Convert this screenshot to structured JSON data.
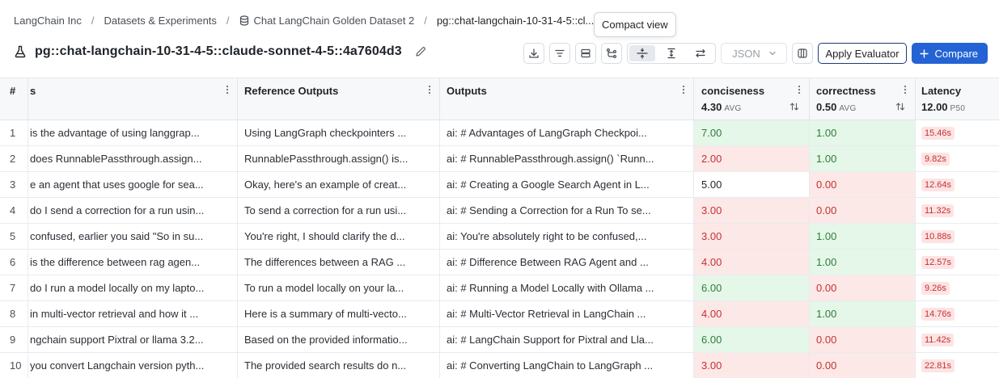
{
  "breadcrumb": {
    "items": [
      "LangChain Inc",
      "Datasets & Experiments",
      "Chat LangChain Golden Dataset 2",
      "pg::chat-langchain-10-31-4-5::cl..."
    ],
    "separator": "/"
  },
  "tooltip": {
    "text": "Compact view"
  },
  "header": {
    "title": "pg::chat-langchain-10-31-4-5::claude-sonnet-4-5::4a7604d3"
  },
  "toolbar": {
    "format_select": "JSON",
    "apply_label": "Apply Evaluator",
    "compare_label": "Compare",
    "icons": [
      "download-icon",
      "filter-icon",
      "rows-icon",
      "branch-icon",
      "compact-view-icon",
      "expand-view-icon",
      "swap-icon",
      "columns-icon"
    ]
  },
  "colors": {
    "accent": "#2463d4",
    "good_bg": "#e5f7e8",
    "good_text": "#2e7d3a",
    "bad_bg": "#fde8e8",
    "bad_text": "#c53030"
  },
  "table": {
    "columns": {
      "num": "#",
      "inputs": "s",
      "reference": "Reference Outputs",
      "outputs": "Outputs",
      "conciseness": {
        "label": "conciseness",
        "value": "4.30",
        "unit": "AVG"
      },
      "correctness": {
        "label": "correctness",
        "value": "0.50",
        "unit": "AVG"
      },
      "latency": {
        "label": "Latency",
        "value": "12.00",
        "unit": "P50"
      }
    },
    "rows": [
      {
        "num": "1",
        "input": "is the advantage of using langgrap...",
        "reference": "Using LangGraph checkpointers ...",
        "output": "ai: # Advantages of LangGraph Checkpoi...",
        "conciseness": "7.00",
        "con_status": "good",
        "correctness": "1.00",
        "cor_status": "good",
        "latency": "15.46s"
      },
      {
        "num": "2",
        "input": "does RunnablePassthrough.assign...",
        "reference": "RunnablePassthrough.assign() is...",
        "output": "ai: # RunnablePassthrough.assign() `Runn...",
        "conciseness": "2.00",
        "con_status": "bad",
        "correctness": "1.00",
        "cor_status": "good",
        "latency": "9.82s"
      },
      {
        "num": "3",
        "input": "e an agent that uses google for sea...",
        "reference": "Okay, here's an example of creat...",
        "output": "ai: # Creating a Google Search Agent in L...",
        "conciseness": "5.00",
        "con_status": "neutral",
        "correctness": "0.00",
        "cor_status": "bad",
        "latency": "12.64s"
      },
      {
        "num": "4",
        "input": "do I send a correction for a run usin...",
        "reference": "To send a correction for a run usi...",
        "output": "ai: # Sending a Correction for a Run To se...",
        "conciseness": "3.00",
        "con_status": "bad",
        "correctness": "0.00",
        "cor_status": "bad",
        "latency": "11.32s"
      },
      {
        "num": "5",
        "input": "confused, earlier you said \"So in su...",
        "reference": "You're right, I should clarify the d...",
        "output": "ai: You're absolutely right to be confused,...",
        "conciseness": "3.00",
        "con_status": "bad",
        "correctness": "1.00",
        "cor_status": "good",
        "latency": "10.88s"
      },
      {
        "num": "6",
        "input": "is the difference between rag agen...",
        "reference": "The differences between a RAG ...",
        "output": "ai: # Difference Between RAG Agent and ...",
        "conciseness": "4.00",
        "con_status": "bad",
        "correctness": "1.00",
        "cor_status": "good",
        "latency": "12.57s"
      },
      {
        "num": "7",
        "input": "do I run a model locally on my lapto...",
        "reference": "To run a model locally on your la...",
        "output": "ai: # Running a Model Locally with Ollama ...",
        "conciseness": "6.00",
        "con_status": "good",
        "correctness": "0.00",
        "cor_status": "bad",
        "latency": "9.26s"
      },
      {
        "num": "8",
        "input": "in multi-vector retrieval and how it ...",
        "reference": "Here is a summary of multi-vecto...",
        "output": "ai: # Multi-Vector Retrieval in LangChain ...",
        "conciseness": "4.00",
        "con_status": "bad",
        "correctness": "1.00",
        "cor_status": "good",
        "latency": "14.76s"
      },
      {
        "num": "9",
        "input": "ngchain support Pixtral or llama 3.2...",
        "reference": "Based on the provided informatio...",
        "output": "ai: # LangChain Support for Pixtral and Lla...",
        "conciseness": "6.00",
        "con_status": "good",
        "correctness": "0.00",
        "cor_status": "bad",
        "latency": "11.42s"
      },
      {
        "num": "10",
        "input": "you convert Langchain version pyth...",
        "reference": "The provided search results do n...",
        "output": "ai: # Converting LangChain to LangGraph ...",
        "conciseness": "3.00",
        "con_status": "bad",
        "correctness": "0.00",
        "cor_status": "bad",
        "latency": "22.81s"
      }
    ]
  }
}
